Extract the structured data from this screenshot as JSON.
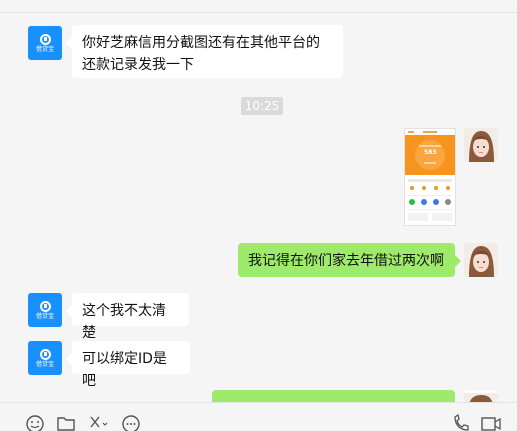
{
  "chat": {
    "timestamp": "10:25",
    "messages": [
      {
        "from": "bot",
        "text": "你好芝麻信用分截图还有在其他平台的还款记录发我一下"
      },
      {
        "from": "user",
        "type": "image",
        "image": {
          "score": "583"
        }
      },
      {
        "from": "user",
        "text": "我记得在你们家去年借过两次啊"
      },
      {
        "from": "bot",
        "text": "这个我不太清楚"
      },
      {
        "from": "bot",
        "text": "可以绑定ID是吧"
      },
      {
        "from": "user",
        "text": ""
      }
    ]
  },
  "bot_avatar": {
    "label": "借贷宝",
    "color": "#1890ff"
  },
  "colors": {
    "user_bubble": "#9eea6a",
    "bot_bubble": "#ffffff",
    "background": "#f5f5f5"
  },
  "toolbar": {
    "icons": [
      "emoji-icon",
      "folder-icon",
      "scissors-icon",
      "chat-history-icon",
      "phone-icon",
      "video-call-icon"
    ]
  }
}
